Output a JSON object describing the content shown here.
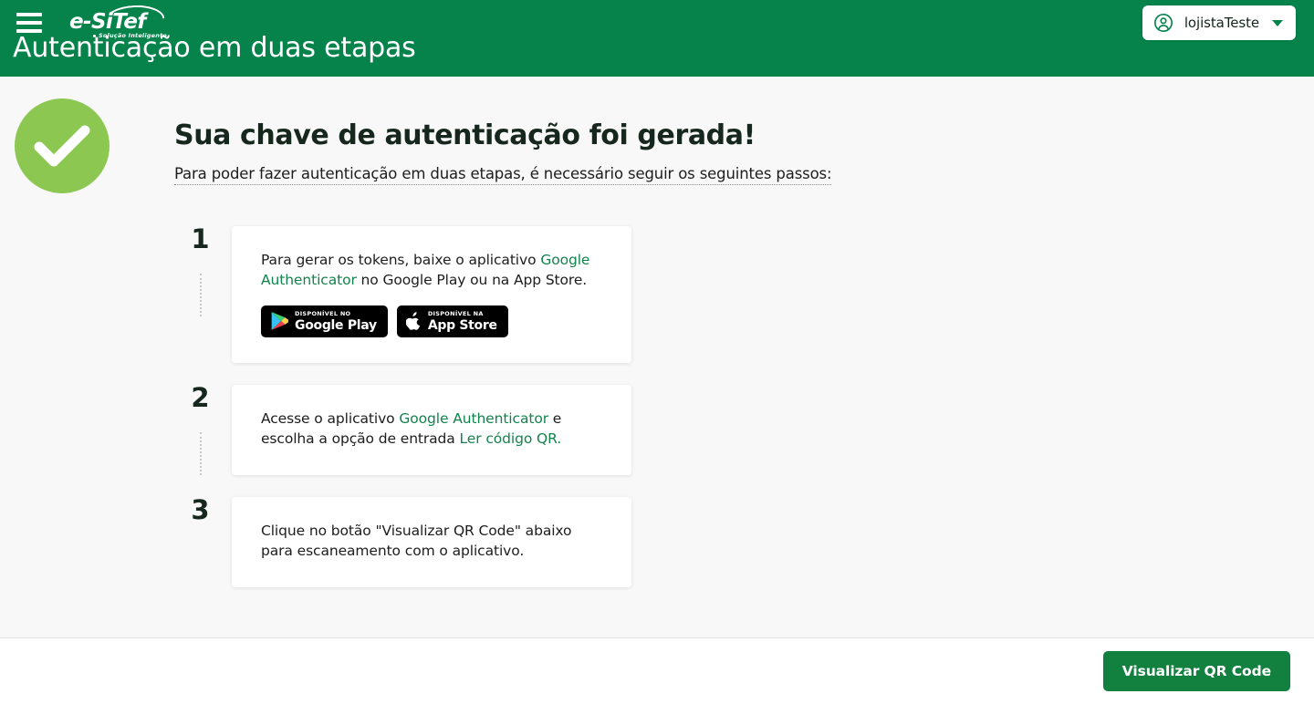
{
  "header": {
    "brand": {
      "name": "e-SiTef",
      "tagline": "Solução Inteligente"
    },
    "menu_icon": "hamburger-icon",
    "page_title": "Autenticação em duas etapas",
    "user": {
      "name": "lojistaTeste",
      "avatar_icon": "user-circle-icon",
      "caret_icon": "chevron-down-icon"
    },
    "colors": {
      "background": "#06834B",
      "text": "#FFFFFF"
    }
  },
  "intro": {
    "status_icon": "check-circle-icon",
    "status_color": "#8CC751",
    "title": "Sua chave de autenticação foi gerada!",
    "subtitle": "Para poder fazer autenticação em duas etapas, é necessário seguir os seguintes passos:"
  },
  "steps": [
    {
      "number": "1",
      "text_parts": [
        {
          "text": "Para gerar os tokens, baixe o aplicativo ",
          "link": false
        },
        {
          "text": "Google Authenticator",
          "link": true
        },
        {
          "text": " no Google Play ou na App Store.",
          "link": false
        }
      ],
      "badges": [
        {
          "icon": "google-play-icon",
          "small": "DISPONÍVEL NO",
          "big": "Google Play"
        },
        {
          "icon": "apple-icon",
          "small": "DISPONÍVEL NA",
          "big": "App Store"
        }
      ]
    },
    {
      "number": "2",
      "text_parts": [
        {
          "text": "Acesse o aplicativo ",
          "link": false
        },
        {
          "text": "Google Authenticator",
          "link": true
        },
        {
          "text": " e escolha a opção de entrada ",
          "link": false
        },
        {
          "text": "Ler código QR.",
          "link": true
        }
      ],
      "badges": []
    },
    {
      "number": "3",
      "text_parts": [
        {
          "text": "Clique no botão \"Visualizar QR Code\" abaixo para escaneamento com o aplicativo.",
          "link": false
        }
      ],
      "badges": []
    }
  ],
  "footer": {
    "primary_button": "Visualizar QR Code",
    "primary_button_color": "#12803F"
  },
  "theme": {
    "link_green": "#12834D",
    "content_background": "#F8F8F8",
    "card_background": "#FFFFFF",
    "heading_color": "#16271D"
  }
}
